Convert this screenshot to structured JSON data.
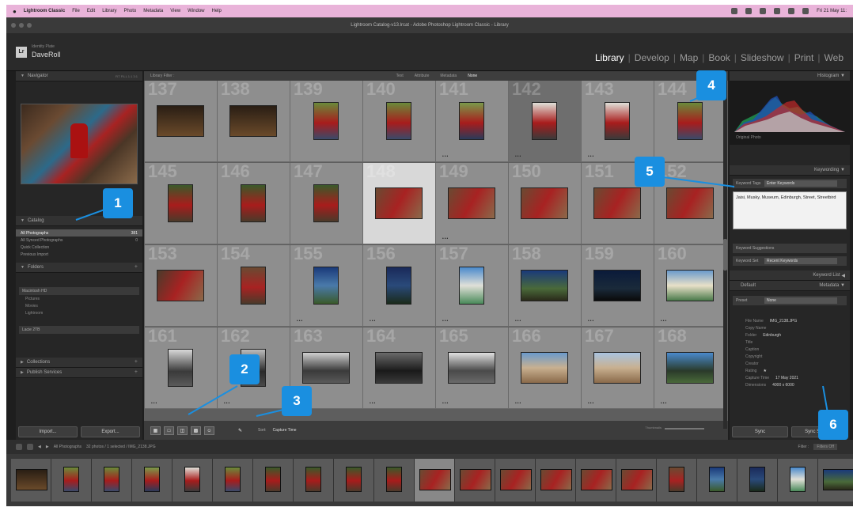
{
  "mac_menu": {
    "app": "Lightroom Classic",
    "items": [
      "File",
      "Edit",
      "Library",
      "Photo",
      "Metadata",
      "View",
      "Window",
      "Help"
    ],
    "clock": "Fri 21 May 11:"
  },
  "window_title": "Lightroom Catalog-v13.lrcat - Adobe Photoshop Lightroom Classic - Library",
  "identity": {
    "catalog_label": "Identity Plate",
    "user": "DaveRoll"
  },
  "modules": {
    "items": [
      "Library",
      "Develop",
      "Map",
      "Book",
      "Slideshow",
      "Print",
      "Web"
    ],
    "active": "Library"
  },
  "left_panel": {
    "navigator": "Navigator",
    "navigator_zoom": "FIT  FILL  1:1  3:1",
    "catalog": "Catalog",
    "catalog_items": [
      {
        "label": "All Photographs",
        "count": "381"
      },
      {
        "label": "All Synced Photographs",
        "count": "0"
      },
      {
        "label": "Quick Collection",
        "count": ""
      },
      {
        "label": "Previous Import",
        "count": ""
      }
    ],
    "folders": "Folders",
    "folder_rows": [
      "Macintosh HD",
      "Lacie 2TB"
    ],
    "sub_rows": [
      "Pictures",
      "Movies",
      "Lightroom"
    ],
    "collections": "Collections",
    "publish": "Publish Services",
    "import_btn": "Import...",
    "export_btn": "Export..."
  },
  "filter_bar": {
    "label": "Library Filter :",
    "tabs": [
      "Text",
      "Attribute",
      "Metadata",
      "None"
    ]
  },
  "grid": {
    "numbers": [
      "137",
      "138",
      "139",
      "140",
      "141",
      "142",
      "143",
      "144",
      "145",
      "146",
      "147",
      "148",
      "149",
      "150",
      "151",
      "152",
      "153",
      "154",
      "155",
      "156",
      "157",
      "158",
      "159",
      "160",
      "161",
      "162",
      "163",
      "164",
      "165",
      "166",
      "167",
      "168"
    ]
  },
  "toolbar": {
    "sort_label": "Sort:",
    "sort_value": "Capture Time",
    "thumbnails": "Thumbnails"
  },
  "right_panel": {
    "histogram": "Histogram",
    "histogram_info": "Original Photo",
    "keywording": "Keywording",
    "keyword_tags": "Keyword Tags",
    "keyword_tags_value": "Enter Keywords",
    "keywords_text": "Jaisi, Musky, Museum, Edinburgh, Street, Streetbird",
    "keyword_suggestions": "Keyword Suggestions",
    "keyword_set": "Keyword Set",
    "keyword_set_value": "Recent Keywords",
    "keyword_list": "Keyword List",
    "metadata": "Metadata",
    "metadata_preset": "Default",
    "preset_label": "Preset",
    "preset_value": "None",
    "fields": [
      {
        "k": "File Name",
        "v": "IMG_2138.JPG"
      },
      {
        "k": "Copy Name",
        "v": ""
      },
      {
        "k": "Folder",
        "v": "Edinburgh"
      },
      {
        "k": "Title",
        "v": ""
      },
      {
        "k": "Caption",
        "v": ""
      },
      {
        "k": "Copyright",
        "v": ""
      },
      {
        "k": "Creator",
        "v": ""
      },
      {
        "k": "Rating",
        "v": "★"
      },
      {
        "k": "Capture Time",
        "v": "17 May 2021"
      },
      {
        "k": "Dimensions",
        "v": "4000 x 6000"
      }
    ],
    "sync_btn": "Sync",
    "sync_settings_btn": "Sync Settings"
  },
  "filmstrip": {
    "source": "All Photographs",
    "count": "32 photos / 1 selected / IMG_2138.JPG",
    "filter": "Filter :",
    "filter_value": "Filters Off"
  },
  "callouts": [
    "1",
    "2",
    "3",
    "4",
    "5",
    "6"
  ]
}
